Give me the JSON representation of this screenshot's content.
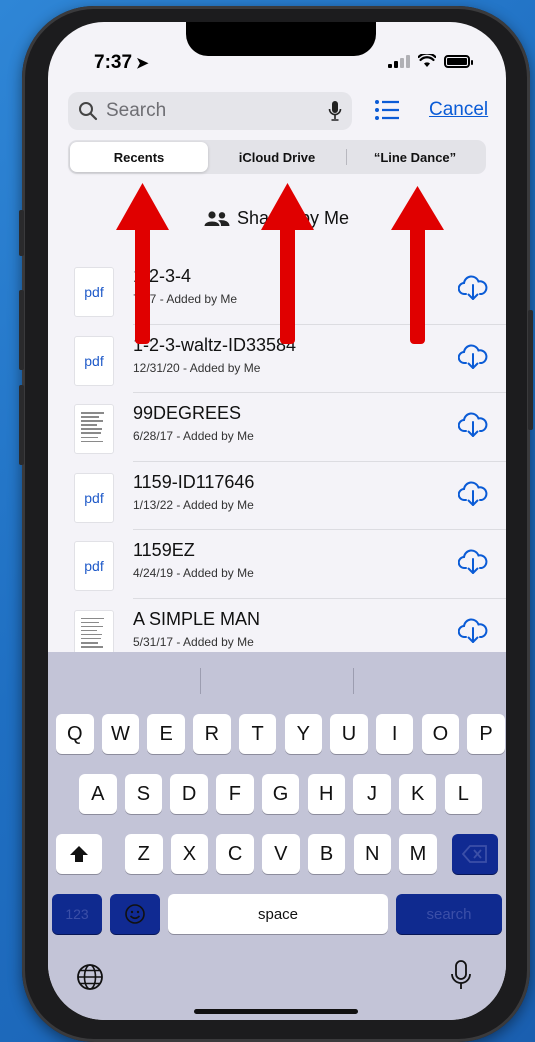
{
  "status": {
    "time": "7:37"
  },
  "search": {
    "placeholder": "Search",
    "cancel": "Cancel"
  },
  "tabs": [
    {
      "label": "Recents",
      "active": true
    },
    {
      "label": "iCloud Drive",
      "active": false
    },
    {
      "label": "“Line Dance”",
      "active": false
    }
  ],
  "shared_label": "Shared by Me",
  "files": [
    {
      "name": "1-2-3-4",
      "meta": "7/17 - Added by Me",
      "thumb": "pdf",
      "icon": "cloud-download-icon"
    },
    {
      "name": "1-2-3-waltz-ID33584",
      "meta": "12/31/20 - Added by Me",
      "thumb": "pdf",
      "icon": "cloud-download-icon"
    },
    {
      "name": "99DEGREES",
      "meta": "6/28/17 - Added by Me",
      "thumb": "doc",
      "icon": "cloud-download-icon"
    },
    {
      "name": "1159-ID117646",
      "meta": "1/13/22 - Added by Me",
      "thumb": "pdf",
      "icon": "cloud-download-icon"
    },
    {
      "name": "1159EZ",
      "meta": "4/24/19 - Added by Me",
      "thumb": "pdf",
      "icon": "cloud-download-icon"
    },
    {
      "name": "A SIMPLE MAN",
      "meta": "5/31/17 - Added by Me",
      "thumb": "doc",
      "icon": "cloud-download-icon"
    }
  ],
  "thumb_label": "pdf",
  "keyboard": {
    "row1": [
      "Q",
      "W",
      "E",
      "R",
      "T",
      "Y",
      "U",
      "I",
      "O",
      "P"
    ],
    "row2": [
      "A",
      "S",
      "D",
      "F",
      "G",
      "H",
      "J",
      "K",
      "L"
    ],
    "row3": [
      "Z",
      "X",
      "C",
      "V",
      "B",
      "N",
      "M"
    ],
    "numbers": "123",
    "space": "space",
    "search": "search"
  },
  "colors": {
    "accent": "#0a5bd6",
    "arrow": "#e00000",
    "keyboard_dark_key": "#0f2a8f"
  }
}
